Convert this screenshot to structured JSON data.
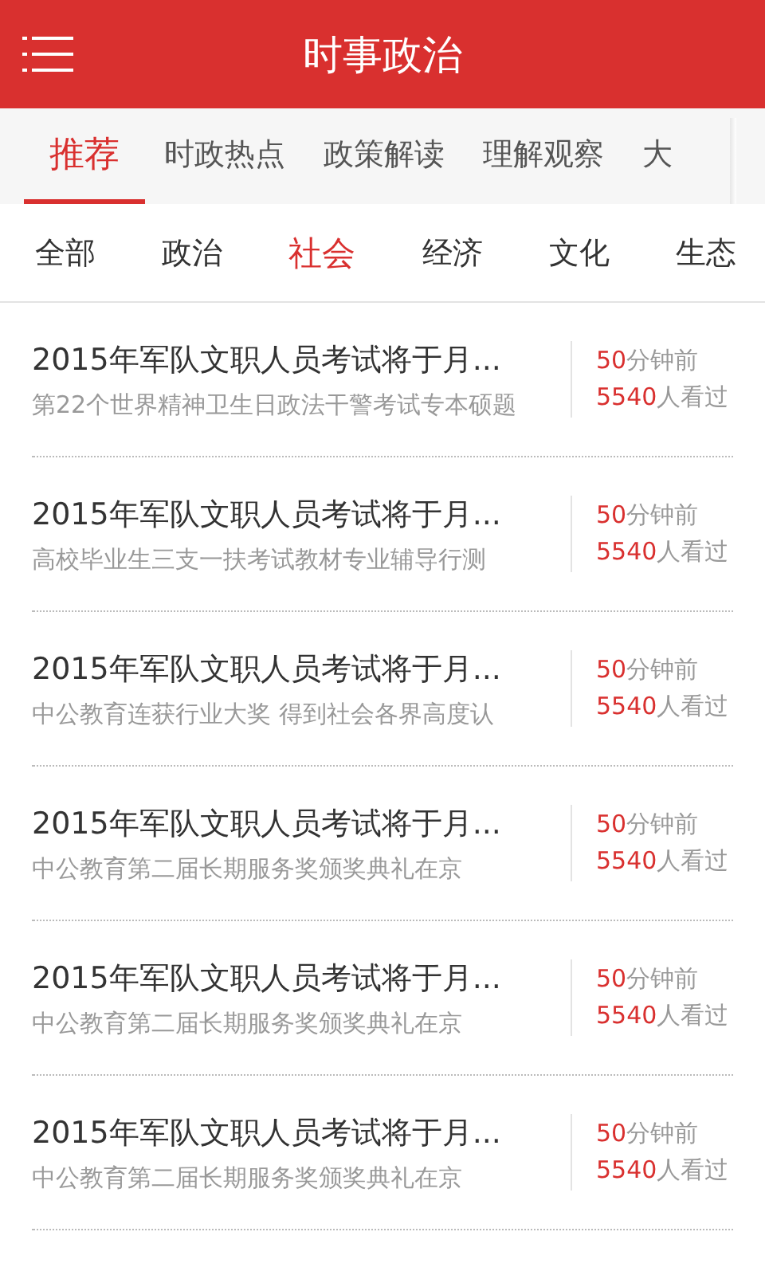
{
  "header": {
    "title": "时事政治"
  },
  "tabs": [
    {
      "label": "推荐",
      "selected": true
    },
    {
      "label": "时政热点",
      "selected": false
    },
    {
      "label": "政策解读",
      "selected": false
    },
    {
      "label": "理解观察",
      "selected": false
    },
    {
      "label": "大",
      "selected": false
    }
  ],
  "categories": [
    {
      "label": "全部",
      "selected": false
    },
    {
      "label": "政治",
      "selected": false
    },
    {
      "label": "社会",
      "selected": true
    },
    {
      "label": "经济",
      "selected": false
    },
    {
      "label": "文化",
      "selected": false
    },
    {
      "label": "生态",
      "selected": false
    }
  ],
  "articles": [
    {
      "title": "2015年军队文职人员考试将于月...",
      "summary": "第22个世界精神卫生日政法干警考试专本硕题",
      "time_value": "50",
      "time_unit": "分钟前",
      "views_value": "5540",
      "views_unit": "人看过"
    },
    {
      "title": "2015年军队文职人员考试将于月...",
      "summary": "高校毕业生三支一扶考试教材专业辅导行测",
      "time_value": "50",
      "time_unit": "分钟前",
      "views_value": "5540",
      "views_unit": "人看过"
    },
    {
      "title": "2015年军队文职人员考试将于月...",
      "summary": "中公教育连获行业大奖 得到社会各界高度认",
      "time_value": "50",
      "time_unit": "分钟前",
      "views_value": "5540",
      "views_unit": "人看过"
    },
    {
      "title": "2015年军队文职人员考试将于月...",
      "summary": "中公教育第二届长期服务奖颁奖典礼在京",
      "time_value": "50",
      "time_unit": "分钟前",
      "views_value": "5540",
      "views_unit": "人看过"
    },
    {
      "title": "2015年军队文职人员考试将于月...",
      "summary": "中公教育第二届长期服务奖颁奖典礼在京",
      "time_value": "50",
      "time_unit": "分钟前",
      "views_value": "5540",
      "views_unit": "人看过"
    },
    {
      "title": "2015年军队文职人员考试将于月...",
      "summary": "中公教育第二届长期服务奖颁奖典礼在京",
      "time_value": "50",
      "time_unit": "分钟前",
      "views_value": "5540",
      "views_unit": "人看过"
    }
  ]
}
